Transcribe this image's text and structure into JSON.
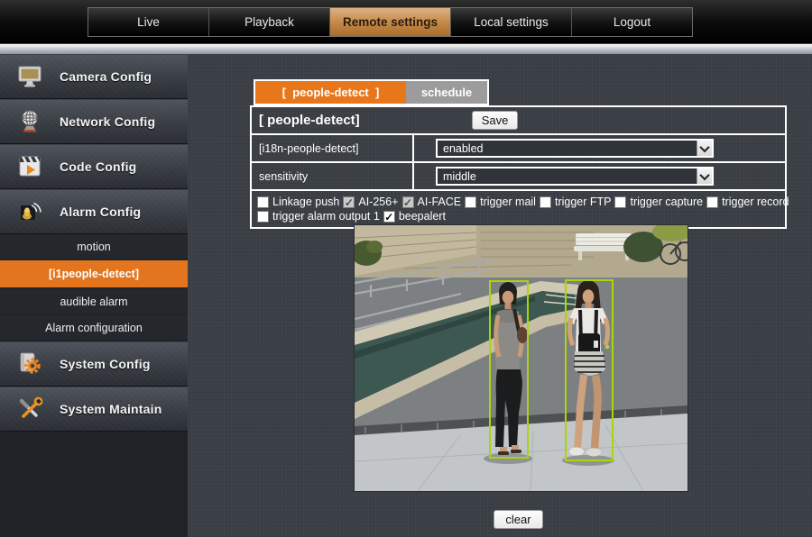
{
  "top_nav": {
    "tabs": [
      {
        "label": "Live",
        "active": false
      },
      {
        "label": "Playback",
        "active": false
      },
      {
        "label": "Remote settings",
        "active": true
      },
      {
        "label": "Local settings",
        "active": false
      },
      {
        "label": "Logout",
        "active": false
      }
    ]
  },
  "sidebar": {
    "sections": [
      {
        "label": "Camera Config",
        "icon": "monitor-icon"
      },
      {
        "label": "Network Config",
        "icon": "globe-icon"
      },
      {
        "label": "Code Config",
        "icon": "clapperboard-icon"
      },
      {
        "label": "Alarm Config",
        "icon": "alarm-horn-icon",
        "expanded": true
      },
      {
        "label": "System Config",
        "icon": "gear-icon"
      },
      {
        "label": "System Maintain",
        "icon": "tools-icon"
      }
    ],
    "alarm_submenu": [
      {
        "label": "motion",
        "active": false
      },
      {
        "label": "[i1people-detect]",
        "active": true
      },
      {
        "label": "audible alarm",
        "active": false
      },
      {
        "label": "Alarm configuration",
        "active": false
      }
    ]
  },
  "content": {
    "tabs": [
      {
        "label": "[  people-detect  ]",
        "active": true
      },
      {
        "label": "schedule",
        "active": false
      }
    ],
    "panel_title": "[ people-detect]",
    "save_label": "Save",
    "clear_label": "clear",
    "rows": [
      {
        "label": "[i18n-people-detect]",
        "value": "enabled",
        "control": "select"
      },
      {
        "label": "sensitivity",
        "value": "middle",
        "control": "select"
      }
    ],
    "checkboxes": [
      {
        "label": "Linkage push",
        "checked": false,
        "muted": false
      },
      {
        "label": "AI-256+",
        "checked": true,
        "muted": true
      },
      {
        "label": "AI-FACE",
        "checked": true,
        "muted": true
      },
      {
        "label": "trigger mail",
        "checked": false,
        "muted": false
      },
      {
        "label": "trigger FTP",
        "checked": false,
        "muted": false
      },
      {
        "label": "trigger capture",
        "checked": false,
        "muted": false
      },
      {
        "label": "trigger record",
        "checked": false,
        "muted": false
      },
      {
        "label": "trigger alarm output 1",
        "checked": false,
        "muted": false
      },
      {
        "label": "beepalert",
        "checked": true,
        "muted": false
      }
    ],
    "preview": {
      "description": "outdoor plaza camera frame with two pedestrians outlined by people-detection bounding boxes",
      "detected_people": 2,
      "box_color": "#a8d608"
    }
  },
  "colors": {
    "accent_orange": "#e8771c",
    "active_nav_tan": "#c68a4a",
    "schedule_tab_gray": "#9c9c9c",
    "background_slate": "#3b3f46",
    "detection_box": "#a8d608"
  }
}
